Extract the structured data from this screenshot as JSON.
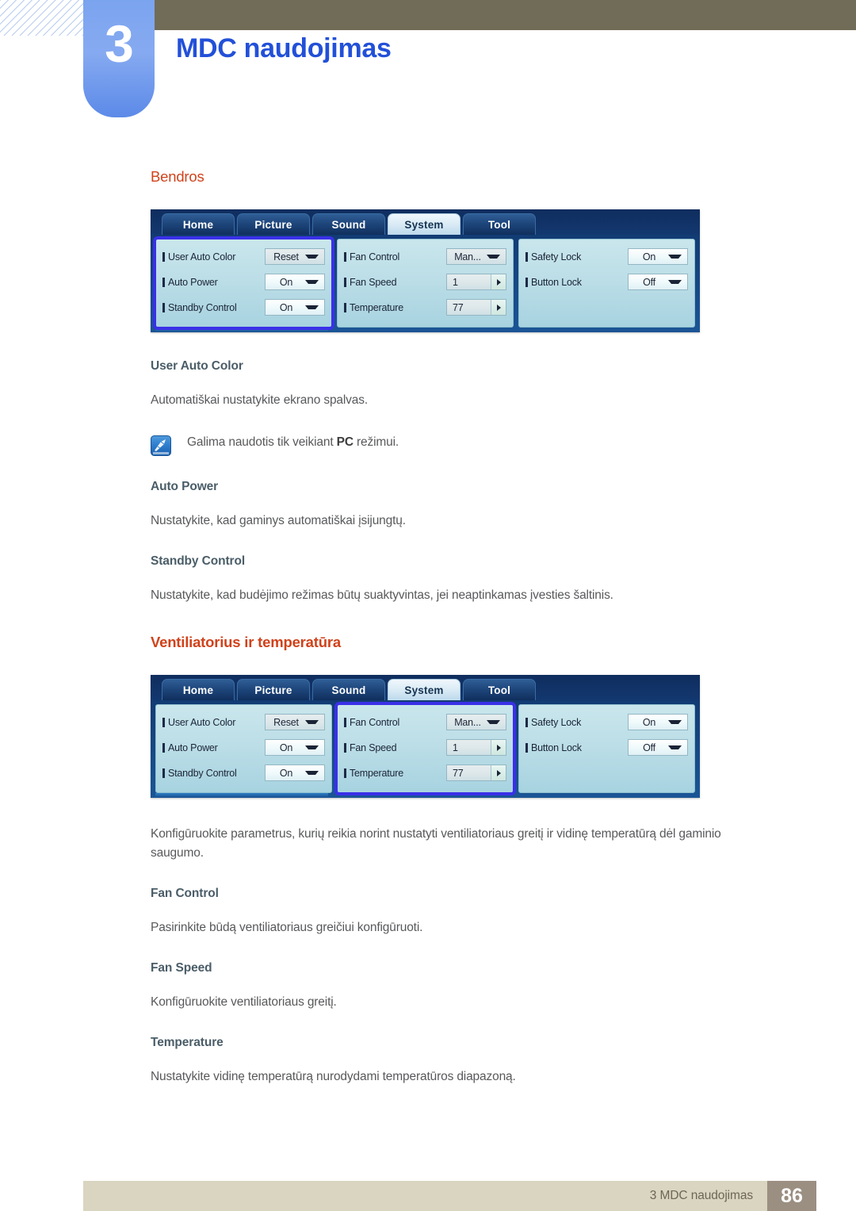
{
  "header": {
    "chapter_number": "3",
    "chapter_title": "MDC naudojimas"
  },
  "sections": {
    "general": {
      "heading": "Bendros",
      "items": [
        {
          "title": "User Auto Color",
          "body": "Automatiškai nustatykite ekrano spalvas.",
          "note_prefix": "Galima naudotis tik veikiant ",
          "note_bold": "PC",
          "note_suffix": " režimui."
        },
        {
          "title": "Auto Power",
          "body": "Nustatykite, kad gaminys automatiškai įsijungtų."
        },
        {
          "title": "Standby Control",
          "body": "Nustatykite, kad budėjimo režimas būtų suaktyvintas, jei neaptinkamas įvesties šaltinis."
        }
      ]
    },
    "fan": {
      "heading": "Ventiliatorius ir temperatūra",
      "intro": "Konfigūruokite parametrus, kurių reikia norint nustatyti ventiliatoriaus greitį ir vidinę temperatūrą dėl gaminio saugumo.",
      "items": [
        {
          "title": "Fan Control",
          "body": "Pasirinkite būdą ventiliatoriaus greičiui konfigūruoti."
        },
        {
          "title": "Fan Speed",
          "body": "Konfigūruokite ventiliatoriaus greitį."
        },
        {
          "title": "Temperature",
          "body": "Nustatykite vidinę temperatūrą nurodydami temperatūros diapazoną."
        }
      ]
    }
  },
  "mdc": {
    "tabs": [
      {
        "label": "Home",
        "active": false
      },
      {
        "label": "Picture",
        "active": false
      },
      {
        "label": "Sound",
        "active": false
      },
      {
        "label": "System",
        "active": true
      },
      {
        "label": "Tool",
        "active": false
      }
    ],
    "group_left": {
      "rows": [
        {
          "label": "User Auto Color",
          "value": "Reset",
          "control": "dropdown"
        },
        {
          "label": "Auto Power",
          "value": "On",
          "control": "dropdown"
        },
        {
          "label": "Standby Control",
          "value": "On",
          "control": "dropdown"
        }
      ]
    },
    "group_middle": {
      "rows": [
        {
          "label": "Fan Control",
          "value": "Man...",
          "control": "dropdown"
        },
        {
          "label": "Fan Speed",
          "value": "1",
          "control": "spinner"
        },
        {
          "label": "Temperature",
          "value": "77",
          "control": "spinner"
        }
      ]
    },
    "group_right": {
      "rows": [
        {
          "label": "Safety Lock",
          "value": "On",
          "control": "dropdown"
        },
        {
          "label": "Button Lock",
          "value": "Off",
          "control": "dropdown"
        }
      ]
    },
    "highlight_first": "left",
    "highlight_second": "middle"
  },
  "footer": {
    "text": "3 MDC naudojimas",
    "page": "86"
  },
  "colors": {
    "accent_orange": "#d0421b",
    "chapter_blue": "#2250d8",
    "subheading": "#4a5d68",
    "body": "#58595b",
    "footer_bar": "#dad5c0",
    "footer_page": "#9b8f82",
    "brown_bar": "#716c57",
    "highlight": "#3a30e8"
  }
}
